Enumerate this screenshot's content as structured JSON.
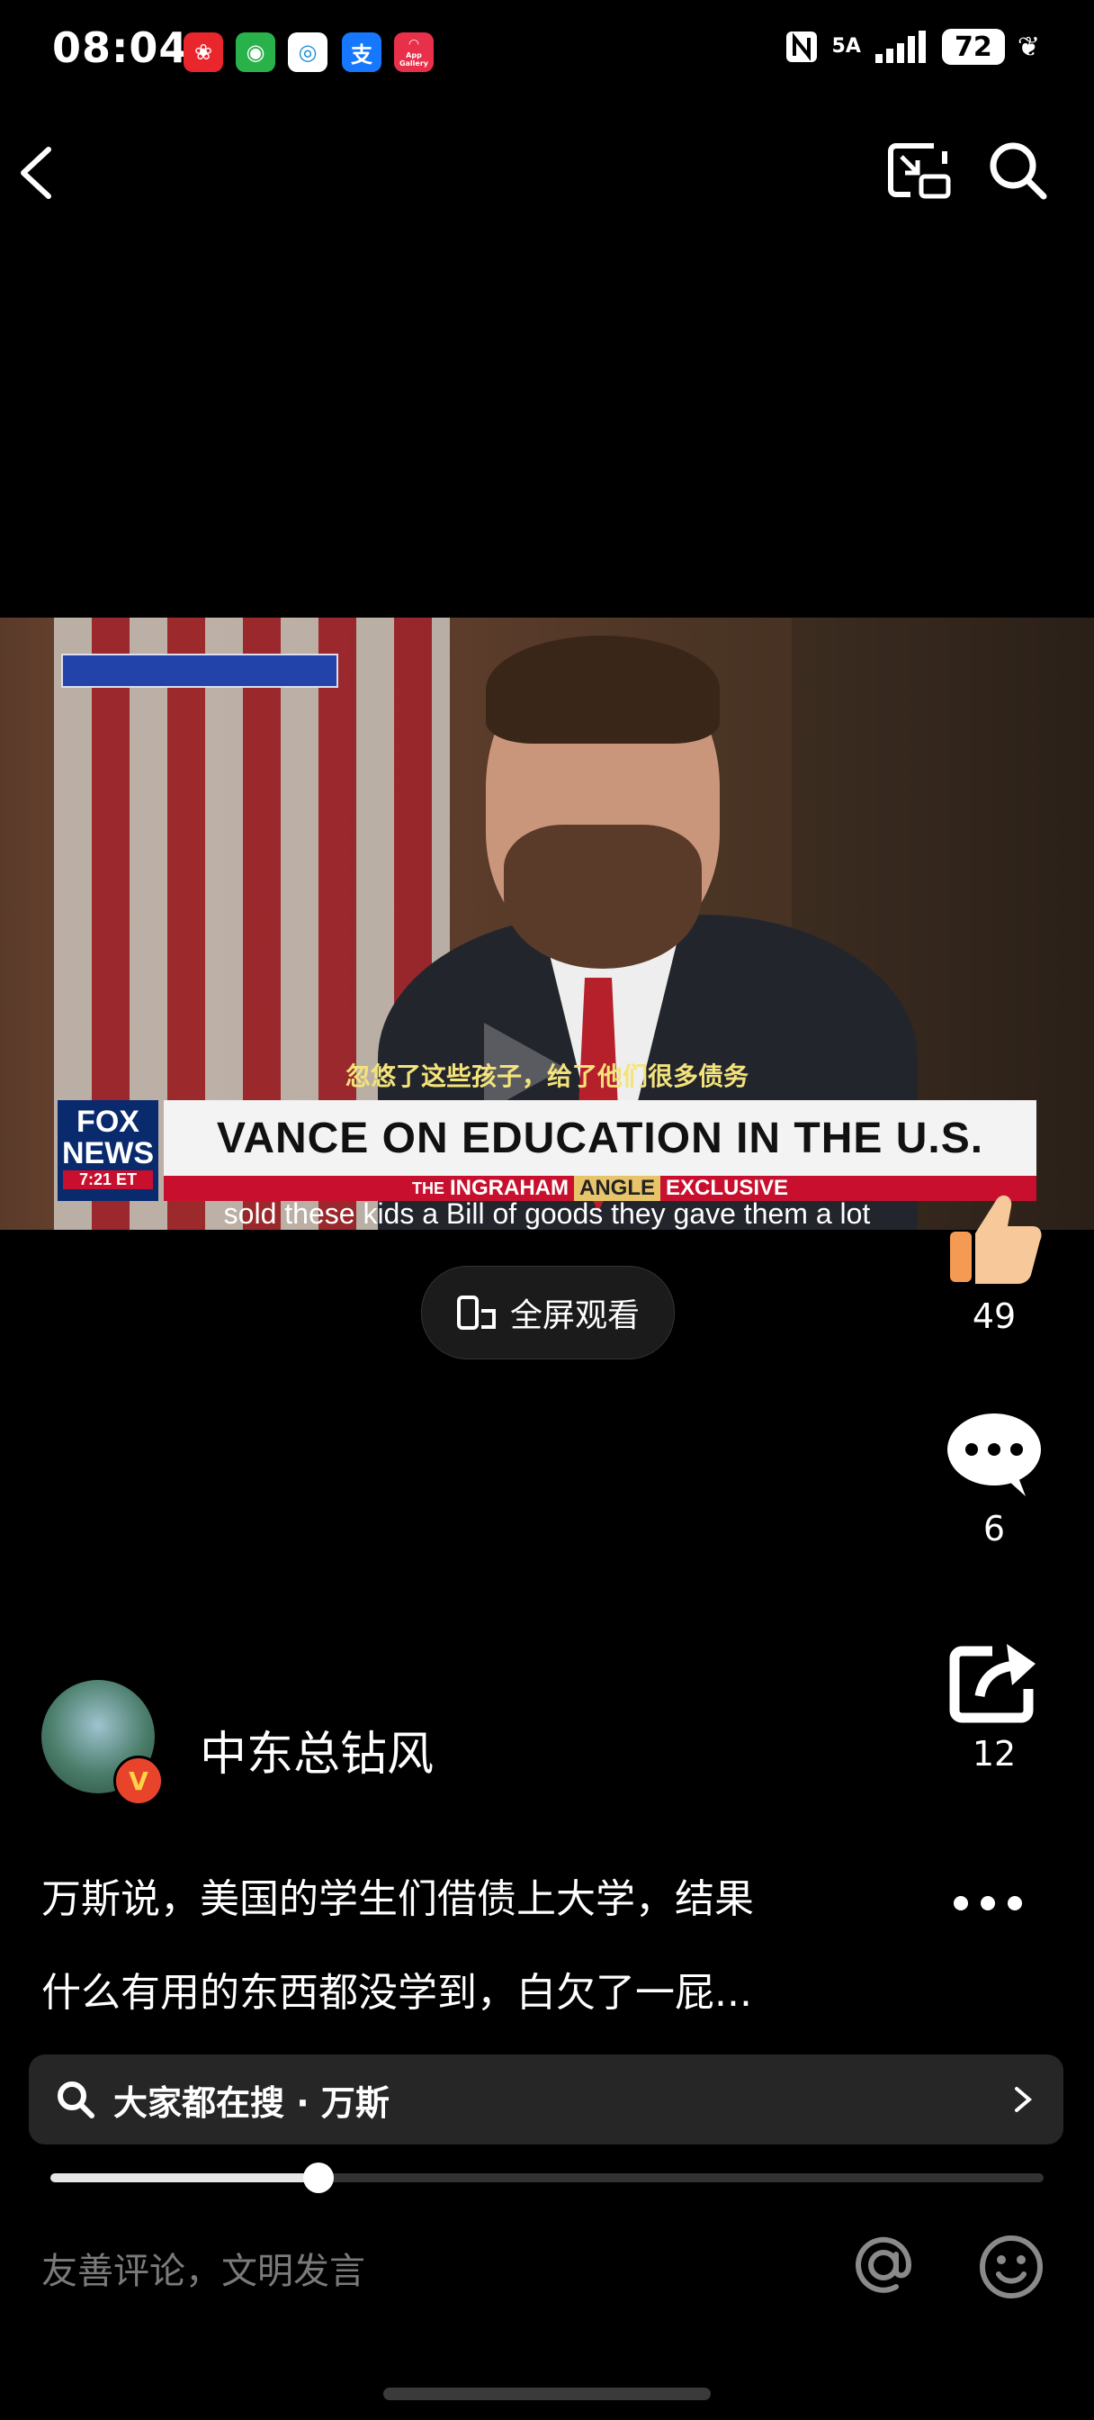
{
  "status_bar": {
    "time": "08:04",
    "network": "5A",
    "battery": "72",
    "app_badge_label": "App Gallery"
  },
  "video": {
    "subtitle_zh": "忽悠了这些孩子，给了他们很多债务",
    "headline": "VANCE ON EDUCATION IN THE U.S.",
    "show_prefix": "THE",
    "show_name": "INGRAHAM",
    "show_angle": "ANGLE",
    "show_tag": "EXCLUSIVE",
    "channel_logo_line1": "FOX",
    "channel_logo_line2": "NEWS",
    "channel_time": "7:21 ET",
    "subtitle_en": "sold these kids a Bill of goods they gave them a lot"
  },
  "fullscreen_label": "全屏观看",
  "actions": {
    "likes": "49",
    "comments": "6",
    "shares": "12"
  },
  "author": {
    "name": "中东总钻风",
    "badge": "V"
  },
  "description": {
    "line1": "万斯说，美国的学生们借债上大学，结果",
    "line2": "什么有用的东西都没学到，白欠了一屁..."
  },
  "search": {
    "text": "大家都在搜 · 万斯"
  },
  "progress": {
    "fraction": 0.27
  },
  "comment_placeholder": "友善评论，文明发言",
  "colors": {
    "background": "#000000",
    "like_hand": "#f7b37a",
    "verified_badge": "#e8442c"
  }
}
